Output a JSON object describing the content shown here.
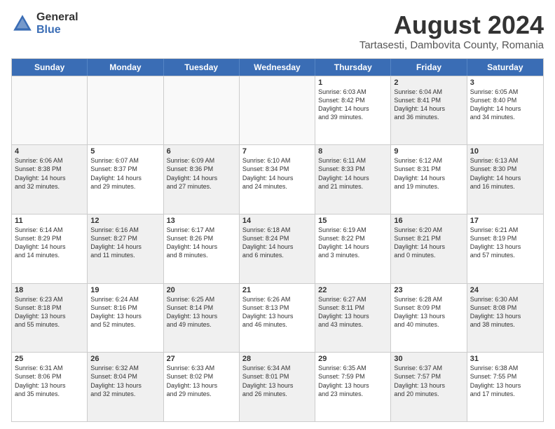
{
  "logo": {
    "general": "General",
    "blue": "Blue"
  },
  "title": "August 2024",
  "subtitle": "Tartasesti, Dambovita County, Romania",
  "header_days": [
    "Sunday",
    "Monday",
    "Tuesday",
    "Wednesday",
    "Thursday",
    "Friday",
    "Saturday"
  ],
  "weeks": [
    [
      {
        "day": "",
        "info": "",
        "shaded": false,
        "empty": true
      },
      {
        "day": "",
        "info": "",
        "shaded": false,
        "empty": true
      },
      {
        "day": "",
        "info": "",
        "shaded": false,
        "empty": true
      },
      {
        "day": "",
        "info": "",
        "shaded": false,
        "empty": true
      },
      {
        "day": "1",
        "info": "Sunrise: 6:03 AM\nSunset: 8:42 PM\nDaylight: 14 hours\nand 39 minutes.",
        "shaded": false,
        "empty": false
      },
      {
        "day": "2",
        "info": "Sunrise: 6:04 AM\nSunset: 8:41 PM\nDaylight: 14 hours\nand 36 minutes.",
        "shaded": true,
        "empty": false
      },
      {
        "day": "3",
        "info": "Sunrise: 6:05 AM\nSunset: 8:40 PM\nDaylight: 14 hours\nand 34 minutes.",
        "shaded": false,
        "empty": false
      }
    ],
    [
      {
        "day": "4",
        "info": "Sunrise: 6:06 AM\nSunset: 8:38 PM\nDaylight: 14 hours\nand 32 minutes.",
        "shaded": true,
        "empty": false
      },
      {
        "day": "5",
        "info": "Sunrise: 6:07 AM\nSunset: 8:37 PM\nDaylight: 14 hours\nand 29 minutes.",
        "shaded": false,
        "empty": false
      },
      {
        "day": "6",
        "info": "Sunrise: 6:09 AM\nSunset: 8:36 PM\nDaylight: 14 hours\nand 27 minutes.",
        "shaded": true,
        "empty": false
      },
      {
        "day": "7",
        "info": "Sunrise: 6:10 AM\nSunset: 8:34 PM\nDaylight: 14 hours\nand 24 minutes.",
        "shaded": false,
        "empty": false
      },
      {
        "day": "8",
        "info": "Sunrise: 6:11 AM\nSunset: 8:33 PM\nDaylight: 14 hours\nand 21 minutes.",
        "shaded": true,
        "empty": false
      },
      {
        "day": "9",
        "info": "Sunrise: 6:12 AM\nSunset: 8:31 PM\nDaylight: 14 hours\nand 19 minutes.",
        "shaded": false,
        "empty": false
      },
      {
        "day": "10",
        "info": "Sunrise: 6:13 AM\nSunset: 8:30 PM\nDaylight: 14 hours\nand 16 minutes.",
        "shaded": true,
        "empty": false
      }
    ],
    [
      {
        "day": "11",
        "info": "Sunrise: 6:14 AM\nSunset: 8:29 PM\nDaylight: 14 hours\nand 14 minutes.",
        "shaded": false,
        "empty": false
      },
      {
        "day": "12",
        "info": "Sunrise: 6:16 AM\nSunset: 8:27 PM\nDaylight: 14 hours\nand 11 minutes.",
        "shaded": true,
        "empty": false
      },
      {
        "day": "13",
        "info": "Sunrise: 6:17 AM\nSunset: 8:26 PM\nDaylight: 14 hours\nand 8 minutes.",
        "shaded": false,
        "empty": false
      },
      {
        "day": "14",
        "info": "Sunrise: 6:18 AM\nSunset: 8:24 PM\nDaylight: 14 hours\nand 6 minutes.",
        "shaded": true,
        "empty": false
      },
      {
        "day": "15",
        "info": "Sunrise: 6:19 AM\nSunset: 8:22 PM\nDaylight: 14 hours\nand 3 minutes.",
        "shaded": false,
        "empty": false
      },
      {
        "day": "16",
        "info": "Sunrise: 6:20 AM\nSunset: 8:21 PM\nDaylight: 14 hours\nand 0 minutes.",
        "shaded": true,
        "empty": false
      },
      {
        "day": "17",
        "info": "Sunrise: 6:21 AM\nSunset: 8:19 PM\nDaylight: 13 hours\nand 57 minutes.",
        "shaded": false,
        "empty": false
      }
    ],
    [
      {
        "day": "18",
        "info": "Sunrise: 6:23 AM\nSunset: 8:18 PM\nDaylight: 13 hours\nand 55 minutes.",
        "shaded": true,
        "empty": false
      },
      {
        "day": "19",
        "info": "Sunrise: 6:24 AM\nSunset: 8:16 PM\nDaylight: 13 hours\nand 52 minutes.",
        "shaded": false,
        "empty": false
      },
      {
        "day": "20",
        "info": "Sunrise: 6:25 AM\nSunset: 8:14 PM\nDaylight: 13 hours\nand 49 minutes.",
        "shaded": true,
        "empty": false
      },
      {
        "day": "21",
        "info": "Sunrise: 6:26 AM\nSunset: 8:13 PM\nDaylight: 13 hours\nand 46 minutes.",
        "shaded": false,
        "empty": false
      },
      {
        "day": "22",
        "info": "Sunrise: 6:27 AM\nSunset: 8:11 PM\nDaylight: 13 hours\nand 43 minutes.",
        "shaded": true,
        "empty": false
      },
      {
        "day": "23",
        "info": "Sunrise: 6:28 AM\nSunset: 8:09 PM\nDaylight: 13 hours\nand 40 minutes.",
        "shaded": false,
        "empty": false
      },
      {
        "day": "24",
        "info": "Sunrise: 6:30 AM\nSunset: 8:08 PM\nDaylight: 13 hours\nand 38 minutes.",
        "shaded": true,
        "empty": false
      }
    ],
    [
      {
        "day": "25",
        "info": "Sunrise: 6:31 AM\nSunset: 8:06 PM\nDaylight: 13 hours\nand 35 minutes.",
        "shaded": false,
        "empty": false
      },
      {
        "day": "26",
        "info": "Sunrise: 6:32 AM\nSunset: 8:04 PM\nDaylight: 13 hours\nand 32 minutes.",
        "shaded": true,
        "empty": false
      },
      {
        "day": "27",
        "info": "Sunrise: 6:33 AM\nSunset: 8:02 PM\nDaylight: 13 hours\nand 29 minutes.",
        "shaded": false,
        "empty": false
      },
      {
        "day": "28",
        "info": "Sunrise: 6:34 AM\nSunset: 8:01 PM\nDaylight: 13 hours\nand 26 minutes.",
        "shaded": true,
        "empty": false
      },
      {
        "day": "29",
        "info": "Sunrise: 6:35 AM\nSunset: 7:59 PM\nDaylight: 13 hours\nand 23 minutes.",
        "shaded": false,
        "empty": false
      },
      {
        "day": "30",
        "info": "Sunrise: 6:37 AM\nSunset: 7:57 PM\nDaylight: 13 hours\nand 20 minutes.",
        "shaded": true,
        "empty": false
      },
      {
        "day": "31",
        "info": "Sunrise: 6:38 AM\nSunset: 7:55 PM\nDaylight: 13 hours\nand 17 minutes.",
        "shaded": false,
        "empty": false
      }
    ]
  ]
}
